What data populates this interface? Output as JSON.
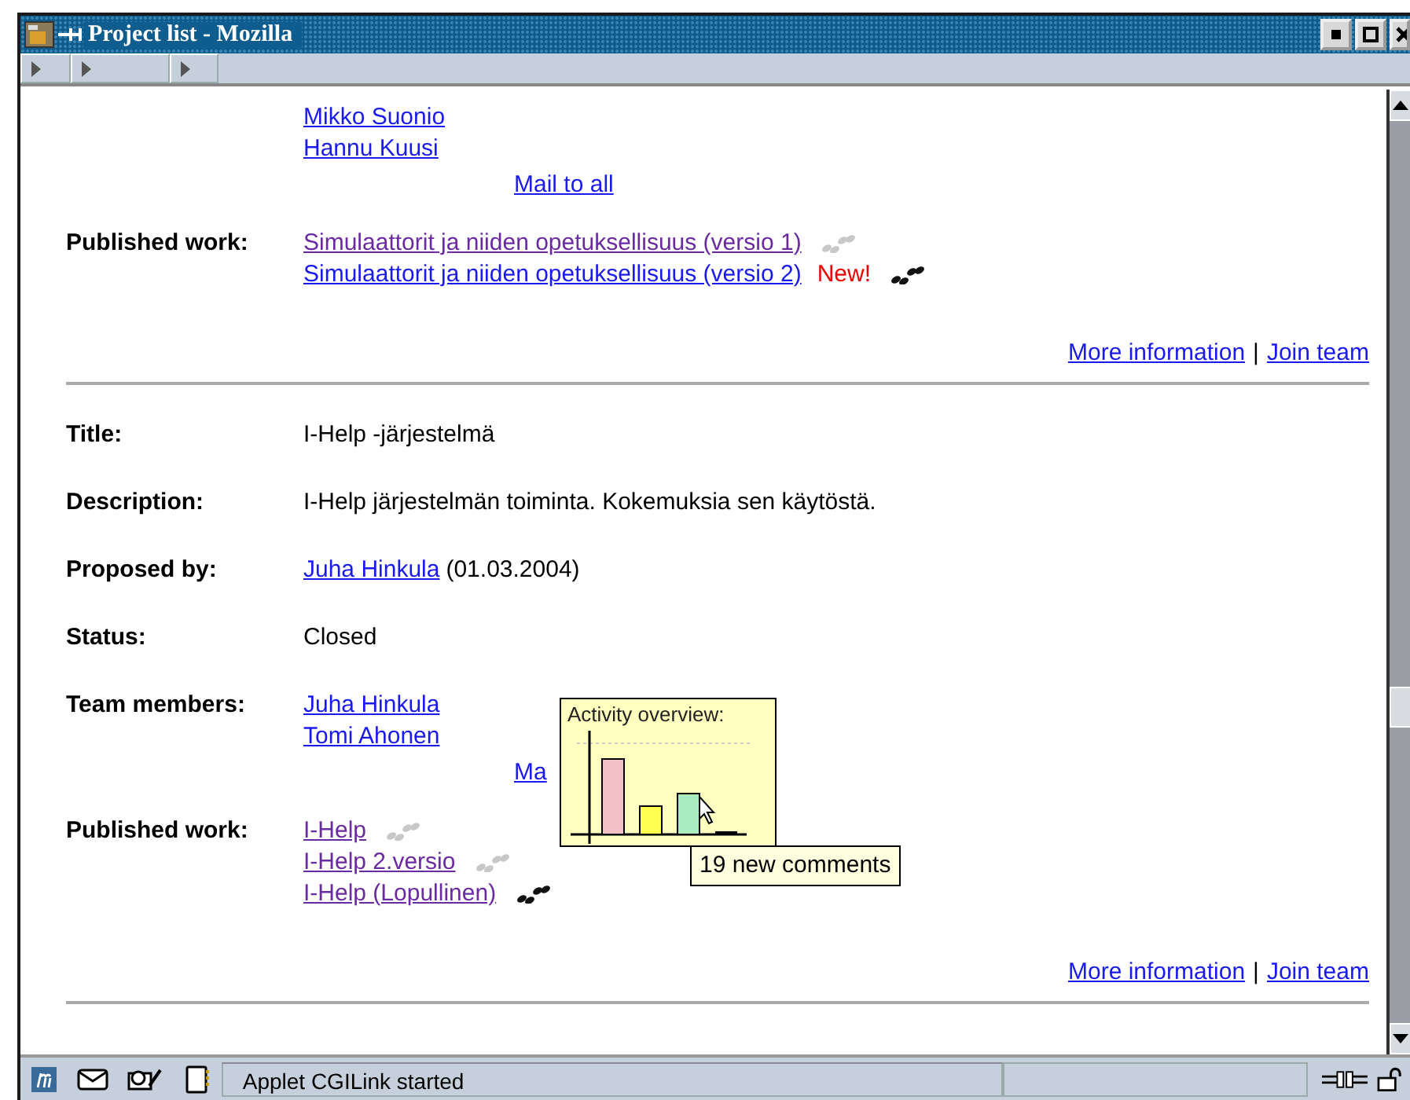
{
  "window": {
    "title": "Project list - Mozilla"
  },
  "projects": [
    {
      "rows": [
        {
          "kind": "members",
          "members": [
            "Mikko Suonio",
            "Hannu Kuusi"
          ],
          "mail_link": "Mail to all"
        },
        {
          "kind": "works",
          "label": "Published work:",
          "works": [
            {
              "title": "Simulaattorit ja niiden opetuksellisuus (versio 1)",
              "visited": true,
              "recent": false
            },
            {
              "title": "Simulaattorit ja niiden opetuksellisuus (versio 2)",
              "visited": false,
              "badge": "New!",
              "recent": true
            }
          ]
        }
      ],
      "footer_links": [
        "More information",
        "Join team"
      ],
      "separator": "|"
    },
    {
      "rows": [
        {
          "kind": "text",
          "label": "Title:",
          "value": "I-Help -järjestelmä"
        },
        {
          "kind": "text",
          "label": "Description:",
          "value": "I-Help järjestelmän toiminta. Kokemuksia sen käytöstä."
        },
        {
          "kind": "person",
          "label": "Proposed by:",
          "person": "Juha Hinkula",
          "note": "(01.03.2004)"
        },
        {
          "kind": "text",
          "label": "Status:",
          "value": "Closed"
        },
        {
          "kind": "members",
          "label": "Team members:",
          "members": [
            "Juha Hinkula",
            "Tomi Ahonen"
          ],
          "mail_link": "Ma",
          "popup": {
            "title": "Activity overview:",
            "hint": "19 new comments"
          }
        },
        {
          "kind": "works",
          "label": "Published work:",
          "works": [
            {
              "title": "I-Help",
              "visited": true,
              "recent": false
            },
            {
              "title": "I-Help 2.versio",
              "visited": true,
              "recent": false
            },
            {
              "title": "I-Help (Lopullinen)",
              "visited": true,
              "recent": true
            }
          ]
        }
      ],
      "footer_links": [
        "More information",
        "Join team"
      ],
      "separator": "|"
    }
  ],
  "status_bar": {
    "message": "Applet CGILink started"
  }
}
